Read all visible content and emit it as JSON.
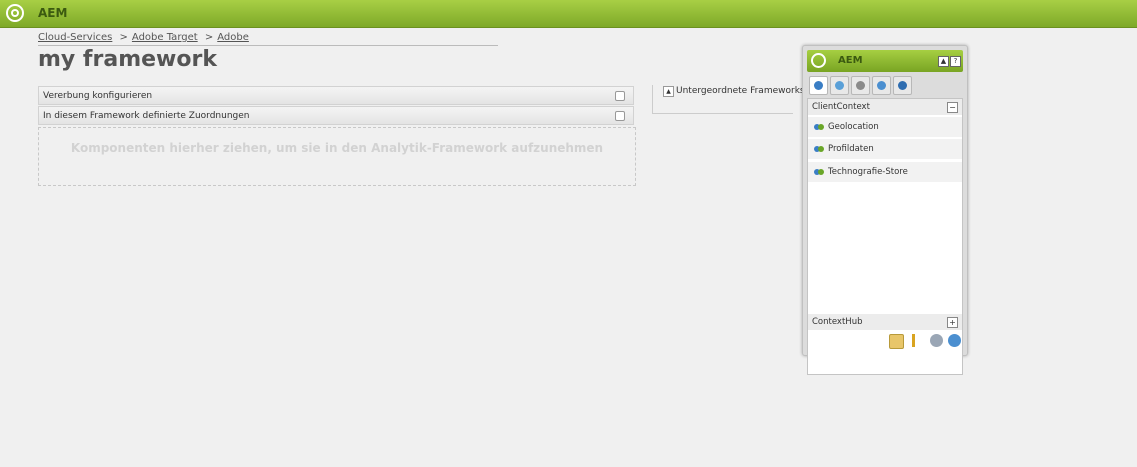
{
  "app": {
    "title": "AEM"
  },
  "breadcrumb": {
    "items": [
      "Cloud-Services",
      "Adobe Target",
      "Adobe"
    ],
    "separator": ">"
  },
  "page": {
    "title": "my framework"
  },
  "panels": [
    {
      "label": "Vererbung konfigurieren"
    },
    {
      "label": "In diesem Framework definierte Zuordnungen"
    }
  ],
  "dropzone": {
    "text": "Komponenten hierher ziehen, um sie in den Analytik-Framework aufzunehmen"
  },
  "subframeworks": {
    "label": "Untergeordnete Frameworks",
    "toggle_icon": "triangle-up-icon"
  },
  "clientcontext_panel": {
    "title": "AEM",
    "header_buttons": [
      "▲",
      "?"
    ],
    "tabs": [
      "profile-tab-icon",
      "page-tab-icon",
      "lock-tab-icon",
      "clock-tab-icon",
      "segment-tab-icon"
    ],
    "section_top": {
      "label": "ClientContext",
      "toggle": "−"
    },
    "items": [
      {
        "label": "Geolocation"
      },
      {
        "label": "Profildaten"
      },
      {
        "label": "Technografie-Store"
      }
    ],
    "section_bottom": {
      "label": "ContextHub",
      "toggle": "+"
    },
    "tools": [
      "pencil-icon",
      "ruler-icon",
      "link-icon",
      "refresh-icon"
    ]
  },
  "colors": {
    "brand_green": "#8ab832",
    "header_text": "#3b5a10"
  }
}
